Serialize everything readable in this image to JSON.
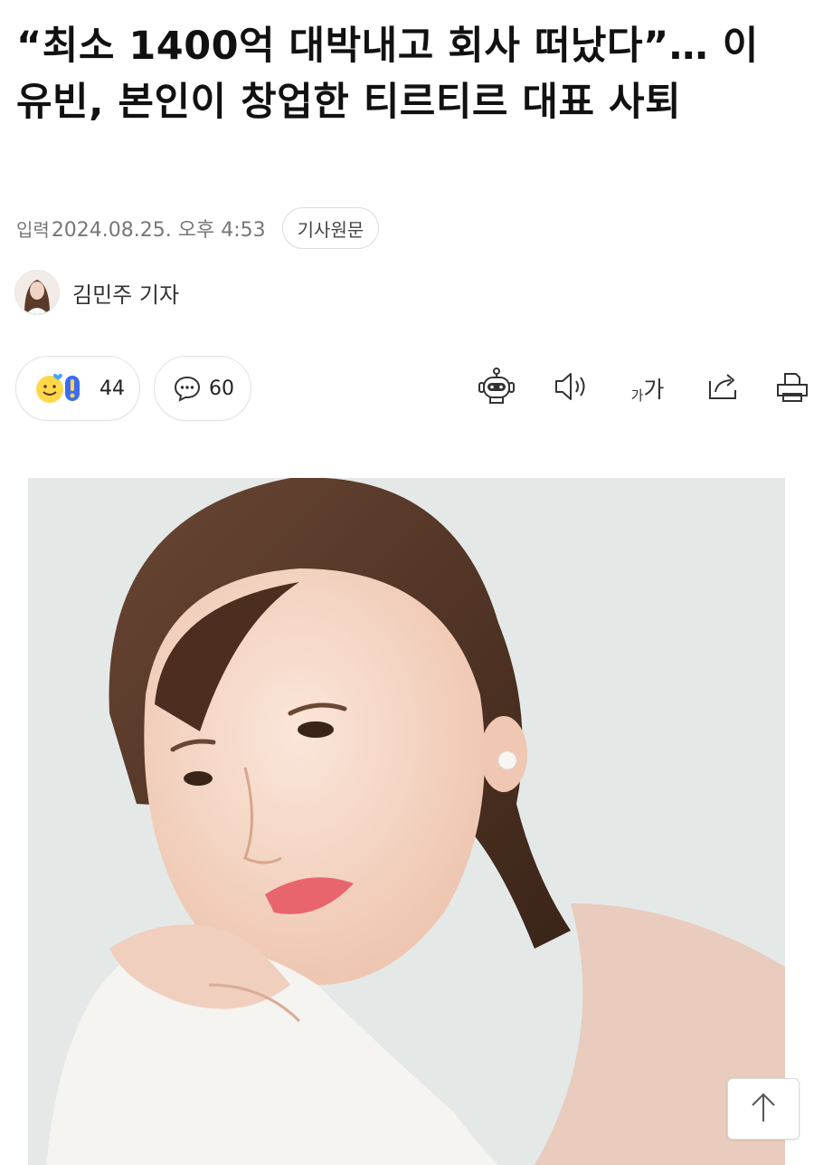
{
  "article": {
    "title": "“최소 1400억 대박내고 회사 떠났다”… 이유빈, 본인이 창업한 티르티르 대표 사퇴",
    "published_label": "입력",
    "published_date": "2024.08.25. 오후 4:53",
    "original_button": "기사원문",
    "reporter_name": "김민주 기자"
  },
  "reactions": {
    "like_count": "44",
    "comment_count": "60"
  },
  "toolbar": {
    "font_size_label_small": "가",
    "font_size_label_large": "가",
    "icons": [
      "robot-summary-icon",
      "speaker-icon",
      "font-size-icon",
      "share-icon",
      "print-icon"
    ]
  },
  "colors": {
    "text": "#111111",
    "meta": "#777777",
    "border": "#e3e3e3"
  }
}
